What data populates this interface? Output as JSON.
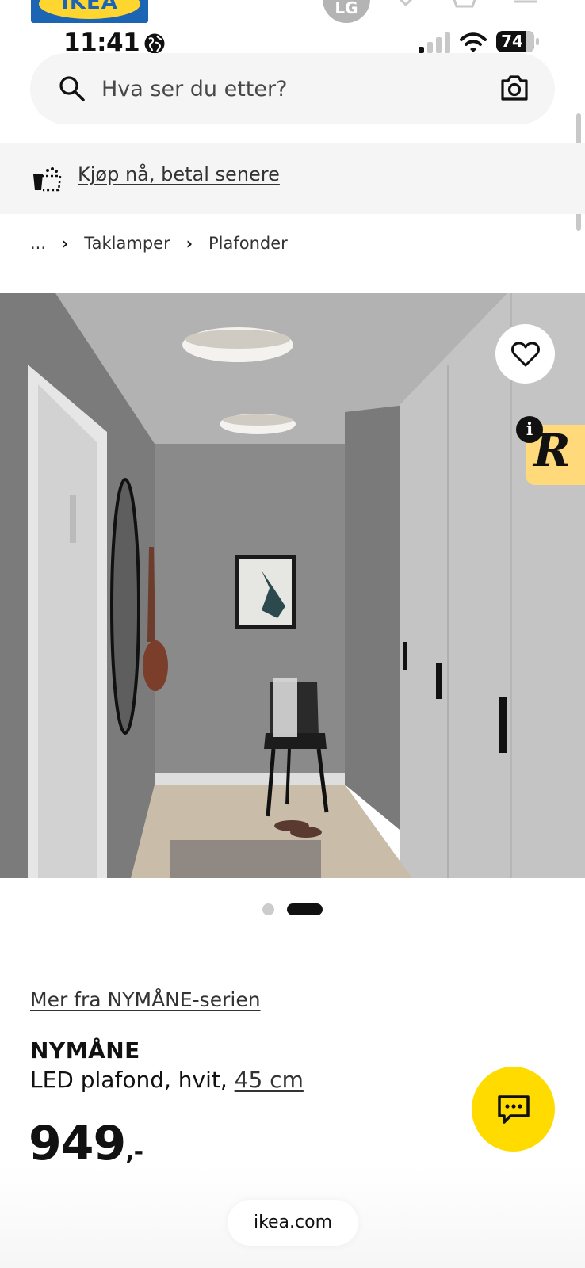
{
  "header": {
    "logo_text": "IKEA",
    "avatar_initials": "LG",
    "icons": [
      "heart-icon",
      "shopping-bag-icon",
      "menu-icon"
    ]
  },
  "status_bar": {
    "time": "11:41",
    "battery": "74",
    "icons": [
      "globe-icon",
      "signal-icon",
      "wifi-icon",
      "battery-icon"
    ]
  },
  "search": {
    "placeholder": "Hva ser du etter?",
    "icons": [
      "search-icon",
      "camera-icon"
    ]
  },
  "banner": {
    "text": "Kjøp nå, betal senere",
    "icon": "pay-later-icon"
  },
  "breadcrumb": {
    "items": [
      "...",
      "Taklamper",
      "Plafonder"
    ],
    "separator": "›"
  },
  "gallery": {
    "image": "hallway-ceiling-lamp-photo",
    "favorite_icon": "heart-icon",
    "badge_letter": "R",
    "badge_info": "i",
    "dots": 2,
    "active_dot": 2
  },
  "product": {
    "series_link": "Mer fra NYMÅNE-serien",
    "name": "NYMÅNE",
    "description": "LED plafond, hvit, ",
    "size": "45 cm",
    "price": "949",
    "price_suffix": ",-"
  },
  "chat": {
    "icon": "chat-icon"
  },
  "browser": {
    "domain": "ikea.com"
  },
  "colors": {
    "ikea_blue": "#1c64b4",
    "ikea_yellow": "#ffdb00",
    "badge_yellow": "#ffd97a",
    "search_bg": "#f5f5f5",
    "banner_bg": "#f5f5f5"
  }
}
